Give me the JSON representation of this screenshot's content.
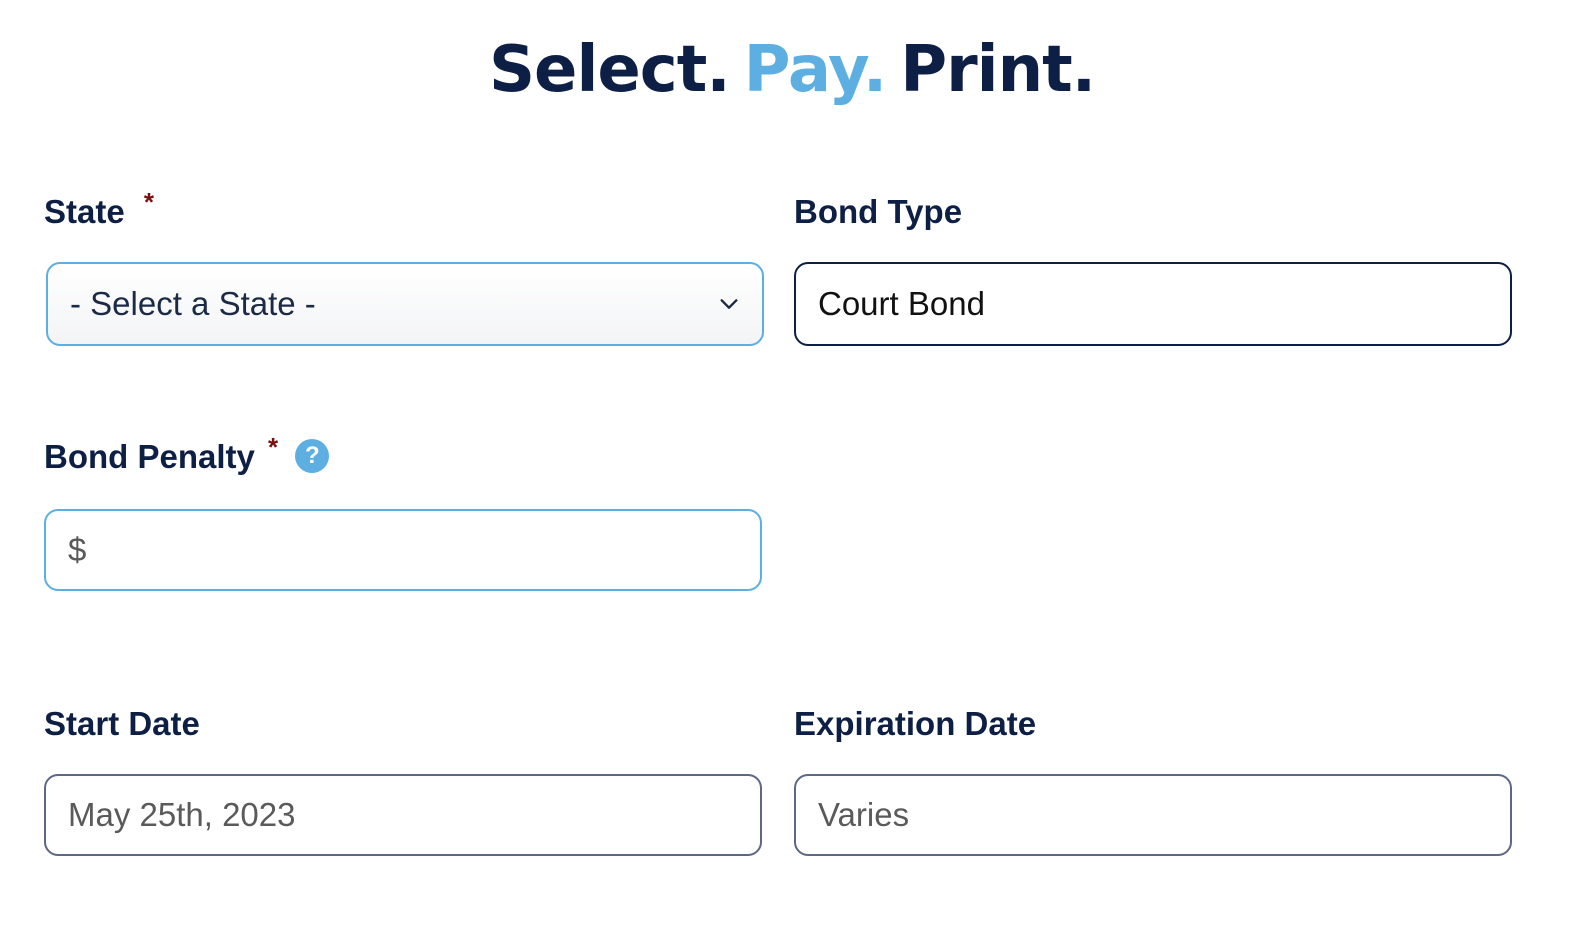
{
  "headline": {
    "word1": "Select.",
    "word2": "Pay.",
    "word3": "Print."
  },
  "form": {
    "state": {
      "label": "State",
      "required_mark": "*",
      "selected": "- Select a State -"
    },
    "bond_type": {
      "label": "Bond Type",
      "value": "Court Bond"
    },
    "bond_penalty": {
      "label": "Bond Penalty",
      "required_mark": "*",
      "help_glyph": "?",
      "prefix": "$",
      "value": ""
    },
    "start_date": {
      "label": "Start Date",
      "value": "May 25th, 2023"
    },
    "expiration_date": {
      "label": "Expiration Date",
      "value": "Varies"
    }
  },
  "colors": {
    "navy": "#0d1f44",
    "accent_blue": "#5dafe2",
    "required_red": "#7a0f0f"
  },
  "icons": {
    "dropdown": "chevron-down-icon",
    "help": "question-circle-icon"
  }
}
